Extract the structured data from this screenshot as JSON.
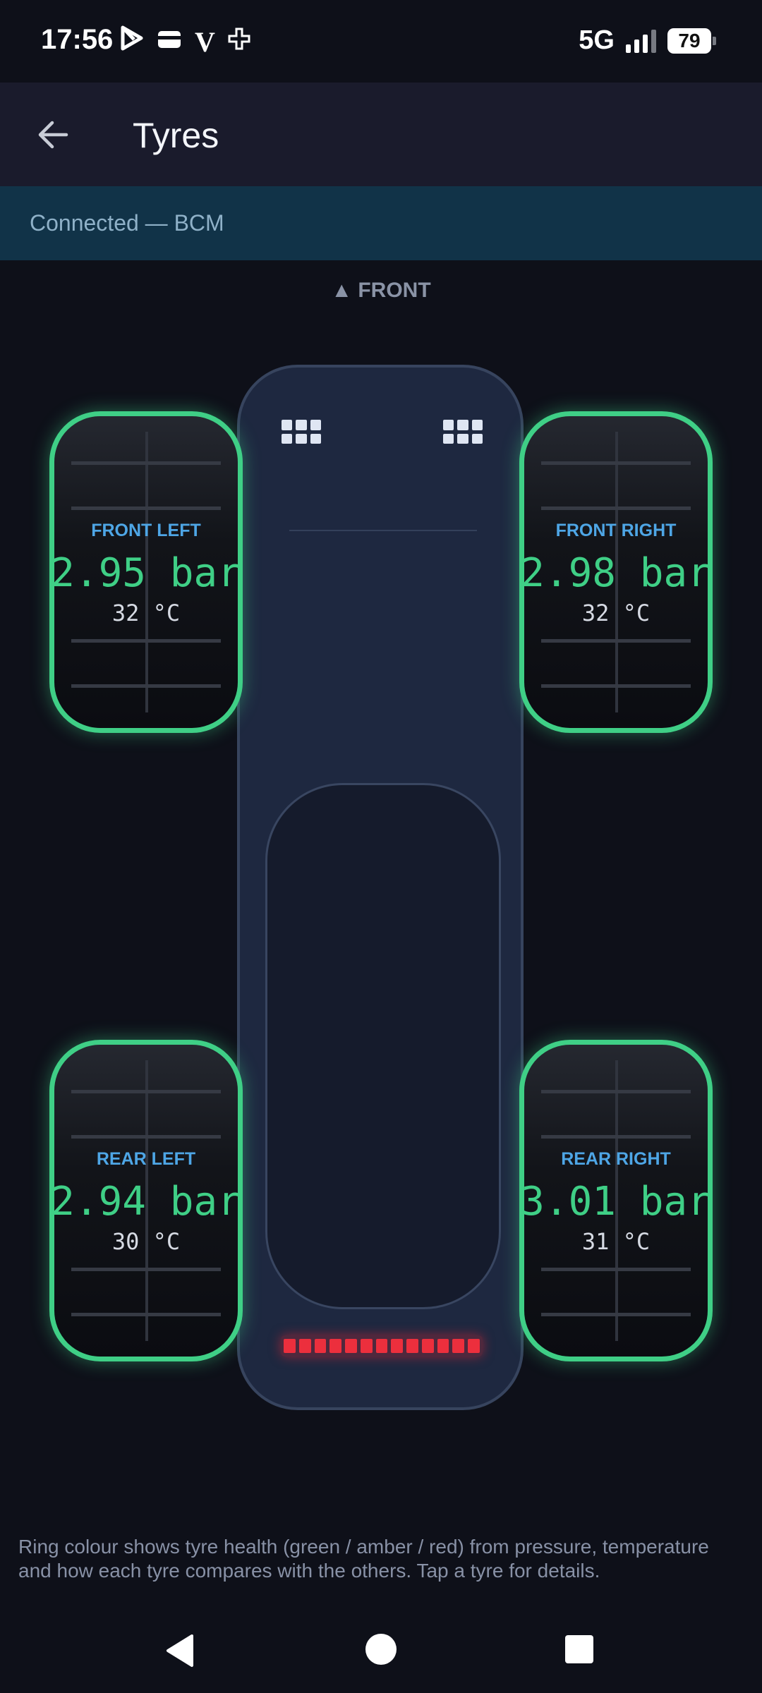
{
  "status_bar": {
    "time": "17:56",
    "notification_icons": [
      "play-store-icon",
      "wallet-icon",
      "v-icon",
      "plus-icon"
    ],
    "network": "5G",
    "signal_bars_level": 3,
    "battery": "79"
  },
  "app_bar": {
    "title": "Tyres",
    "back_icon": "arrow-left-icon"
  },
  "connection": {
    "text": "Connected — BCM"
  },
  "front_label": "▲ FRONT",
  "tyres": {
    "front_left": {
      "name": "FRONT LEFT",
      "pressure": "2.95 bar",
      "temperature": "32 °C"
    },
    "front_right": {
      "name": "FRONT RIGHT",
      "pressure": "2.98 bar",
      "temperature": "32 °C"
    },
    "rear_left": {
      "name": "REAR LEFT",
      "pressure": "2.94 bar",
      "temperature": "30 °C"
    },
    "rear_right": {
      "name": "REAR RIGHT",
      "pressure": "3.01 bar",
      "temperature": "31 °C"
    }
  },
  "colors": {
    "healthy_ring": "#3fcf86",
    "tyre_label": "#4ea6e6",
    "taillight": "#ec2f3d",
    "banner": "#113348"
  },
  "footnote": "Ring colour shows tyre health (green / amber / red) from pressure, temperature and how each tyre compares with the others. Tap a tyre for details.",
  "nav_bar": {
    "items": [
      "back-triangle-icon",
      "home-circle-icon",
      "recents-square-icon"
    ]
  }
}
